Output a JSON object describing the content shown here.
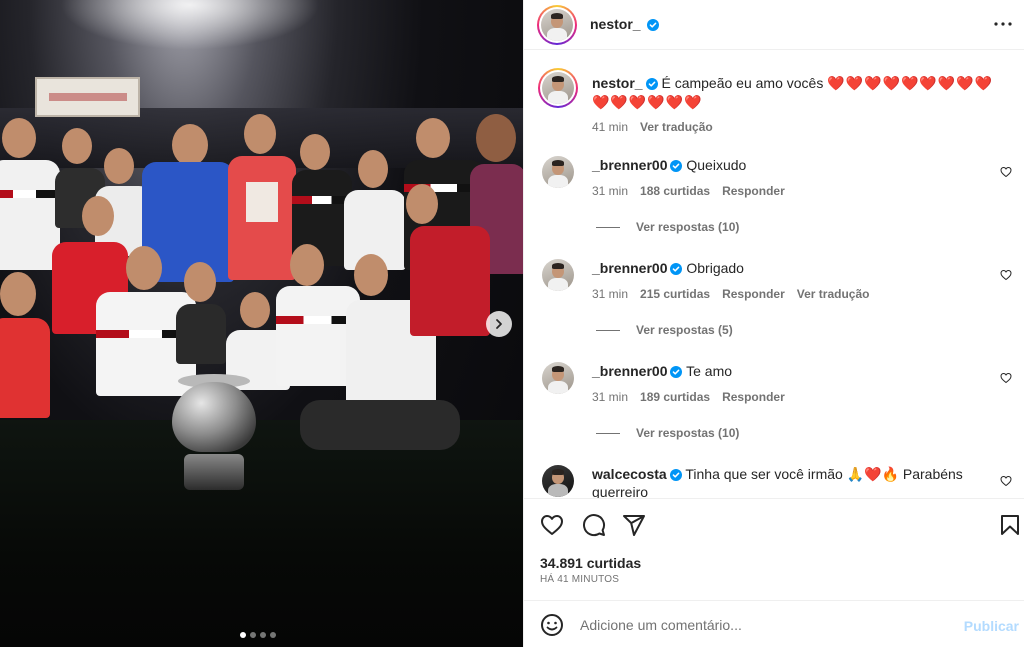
{
  "post": {
    "username": "nestor_",
    "caption_text": "É campeão eu amo vocês",
    "caption_hearts_line1": "❤️❤️❤️❤️❤️❤️❤️❤️❤️",
    "caption_hearts_line2": "❤️❤️❤️❤️❤️❤️",
    "caption_time": "41 min",
    "caption_translate": "Ver tradução",
    "likes": "34.891 curtidas",
    "posted_ago": "HÁ 41 MINUTOS",
    "carousel": {
      "total": 4,
      "active": 1
    }
  },
  "comments": [
    {
      "username": "_brenner00",
      "text": "Queixudo",
      "time": "31 min",
      "likes": "188 curtidas",
      "reply": "Responder",
      "translate": "",
      "view_replies": "Ver respostas (10)"
    },
    {
      "username": "_brenner00",
      "text": "Obrigado",
      "time": "31 min",
      "likes": "215 curtidas",
      "reply": "Responder",
      "translate": "Ver tradução",
      "view_replies": "Ver respostas (5)"
    },
    {
      "username": "_brenner00",
      "text": "Te amo",
      "time": "31 min",
      "likes": "189 curtidas",
      "reply": "Responder",
      "translate": "",
      "view_replies": "Ver respostas (10)"
    },
    {
      "username": "walcecosta",
      "text": "Tinha que ser você irmão 🙏❤️🔥 Parabéns guerreiro"
    }
  ],
  "composer": {
    "placeholder": "Adicione um comentário...",
    "publish": "Publicar"
  },
  "icons": {
    "verified": "verified-badge-icon",
    "more": "more-options-icon",
    "like": "heart-icon",
    "comment": "comment-icon",
    "share": "share-icon",
    "save": "bookmark-icon",
    "emoji": "emoji-icon",
    "next": "chevron-right-icon"
  },
  "colors": {
    "verified": "#0095f6",
    "heart": "#e0112c",
    "muted": "#737373",
    "publish_disabled": "#b3dbff"
  }
}
